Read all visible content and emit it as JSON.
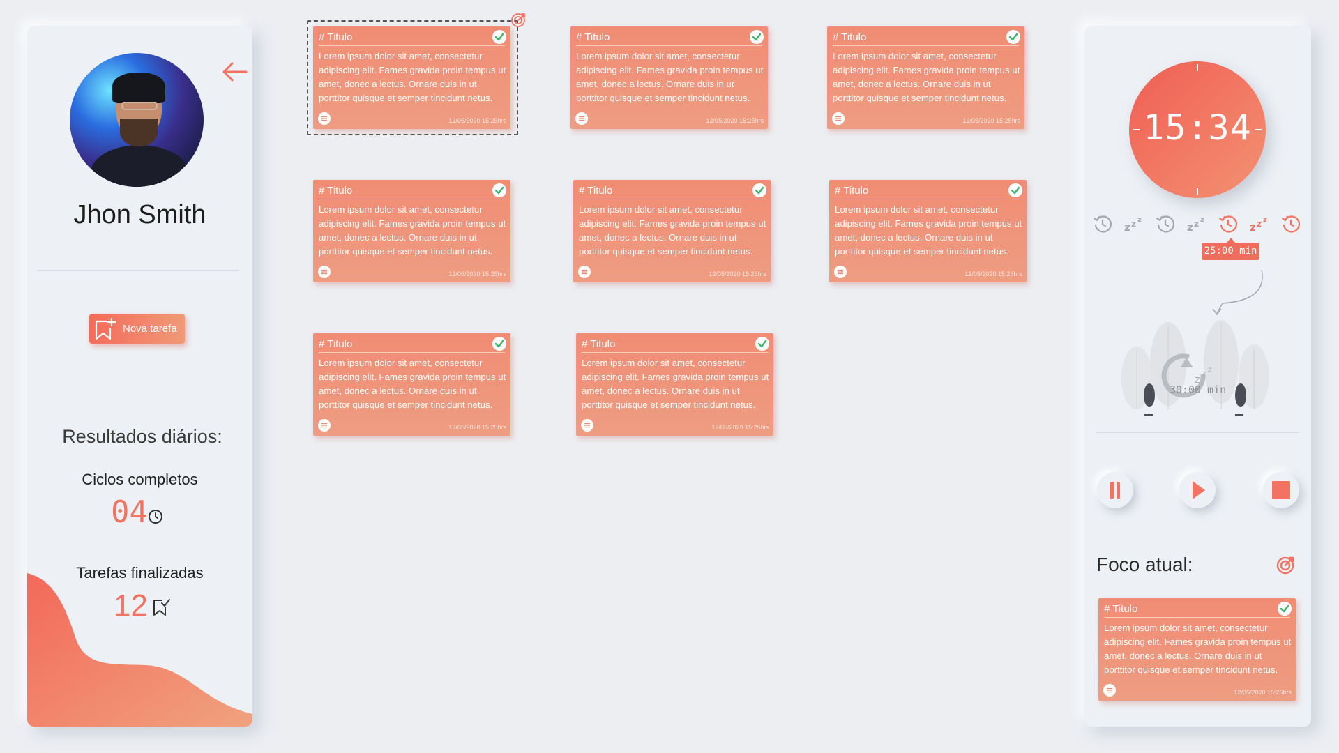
{
  "profile": {
    "name": "Jhon Smith",
    "new_task_label": "Nova tarefa",
    "results_title": "Resultados diários:",
    "cycles_label": "Ciclos completos",
    "cycles_value": "04",
    "tasks_label": "Tarefas finalizadas",
    "tasks_value": "12"
  },
  "cards": [
    {
      "title": "# Titulo",
      "body": "Lorem ipsum dolor sit amet, consectetur adipiscing elit. Fames gravida proin tempus ut amet, donec a lectus. Ornare duis in ut porttitor quisque et semper tincidunt netus.",
      "date": "12/05/2020 15:25hrs"
    },
    {
      "title": "# Titulo",
      "body": "Lorem ipsum dolor sit amet, consectetur adipiscing elit. Fames gravida proin tempus ut amet, donec a lectus. Ornare duis in ut porttitor quisque et semper tincidunt netus.",
      "date": "12/05/2020 15:25hrs"
    },
    {
      "title": "# Titulo",
      "body": "Lorem ipsum dolor sit amet, consectetur adipiscing elit. Fames gravida proin tempus ut amet, donec a lectus. Ornare duis in ut porttitor quisque et semper tincidunt netus.",
      "date": "12/05/2020 15:25hrs"
    },
    {
      "title": "# Titulo",
      "body": "Lorem ipsum dolor sit amet, consectetur adipiscing elit. Fames gravida proin tempus ut amet, donec a lectus. Ornare duis in ut porttitor quisque et semper tincidunt netus.",
      "date": "12/05/2020 15:25hrs"
    },
    {
      "title": "# Titulo",
      "body": "Lorem ipsum dolor sit amet, consectetur adipiscing elit. Fames gravida proin tempus ut amet, donec a lectus. Ornare duis in ut porttitor quisque et semper tincidunt netus.",
      "date": "12/05/2020 15:25hrs"
    },
    {
      "title": "# Titulo",
      "body": "Lorem ipsum dolor sit amet, consectetur adipiscing elit. Fames gravida proin tempus ut amet, donec a lectus. Ornare duis in ut porttitor quisque et semper tincidunt netus.",
      "date": "12/05/2020 15:25hrs"
    },
    {
      "title": "# Titulo",
      "body": "Lorem ipsum dolor sit amet, consectetur adipiscing elit. Fames gravida proin tempus ut amet, donec a lectus. Ornare duis in ut porttitor quisque et semper tincidunt netus.",
      "date": "12/05/2020 15:25hrs"
    },
    {
      "title": "# Titulo",
      "body": "Lorem ipsum dolor sit amet, consectetur adipiscing elit. Fames gravida proin tempus ut amet, donec a lectus. Ornare duis in ut porttitor quisque et semper tincidunt netus.",
      "date": "12/05/2020 15:25hrs"
    }
  ],
  "timer": {
    "time": "15:34",
    "focus_duration": "25:00 min",
    "rest_duration": "30:00 min",
    "cycles": [
      "focus-clock-icon",
      "snooze-icon",
      "focus-clock-icon",
      "snooze-icon",
      "focus-clock-icon",
      "snooze-icon",
      "focus-clock-icon"
    ],
    "active_cycle": 4,
    "focus_label": "Foco atual:"
  },
  "focus_card": {
    "title": "# Titulo",
    "body": "Lorem ipsum dolor sit amet, consectetur adipiscing elit. Fames gravida proin tempus ut amet, donec a lectus. Ornare duis in ut porttitor quisque et semper tincidunt netus.",
    "date": "12/05/2020 15:25hrs"
  },
  "colors": {
    "accent": "#f27362",
    "card_top": "#f08c74",
    "card_bottom": "#ee9d82",
    "background": "#eceef2",
    "muted_icon": "#a4a7ad"
  }
}
